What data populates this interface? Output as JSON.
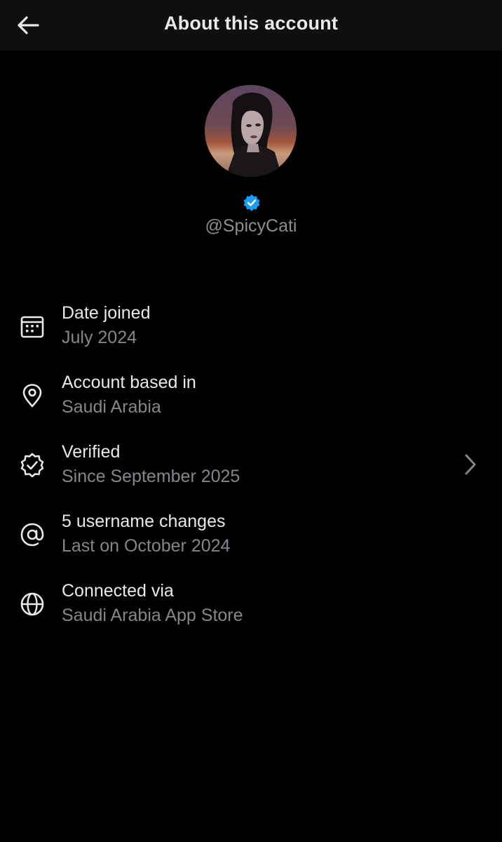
{
  "header": {
    "title": "About this account",
    "back_icon": "arrow-left-icon"
  },
  "profile": {
    "handle": "@SpicyCati",
    "verified_icon": "verified-badge-icon",
    "badge_color": "#1d9bf0"
  },
  "details": [
    {
      "icon": "calendar-icon",
      "title": "Date joined",
      "subtitle": "July 2024"
    },
    {
      "icon": "location-pin-icon",
      "title": "Account based in",
      "subtitle": "Saudi Arabia"
    },
    {
      "icon": "verified-check-icon",
      "title": "Verified",
      "subtitle": "Since September 2025",
      "chevron": "chevron-right-icon"
    },
    {
      "icon": "at-sign-icon",
      "title": "5 username changes",
      "subtitle": "Last on October 2024"
    },
    {
      "icon": "globe-icon",
      "title": "Connected via",
      "subtitle": "Saudi Arabia App Store"
    }
  ],
  "colors": {
    "background": "#000000",
    "header_background": "#0f0f0f",
    "primary_text": "#e7e9ea",
    "secondary_text": "#83878c",
    "accent": "#1d9bf0"
  }
}
